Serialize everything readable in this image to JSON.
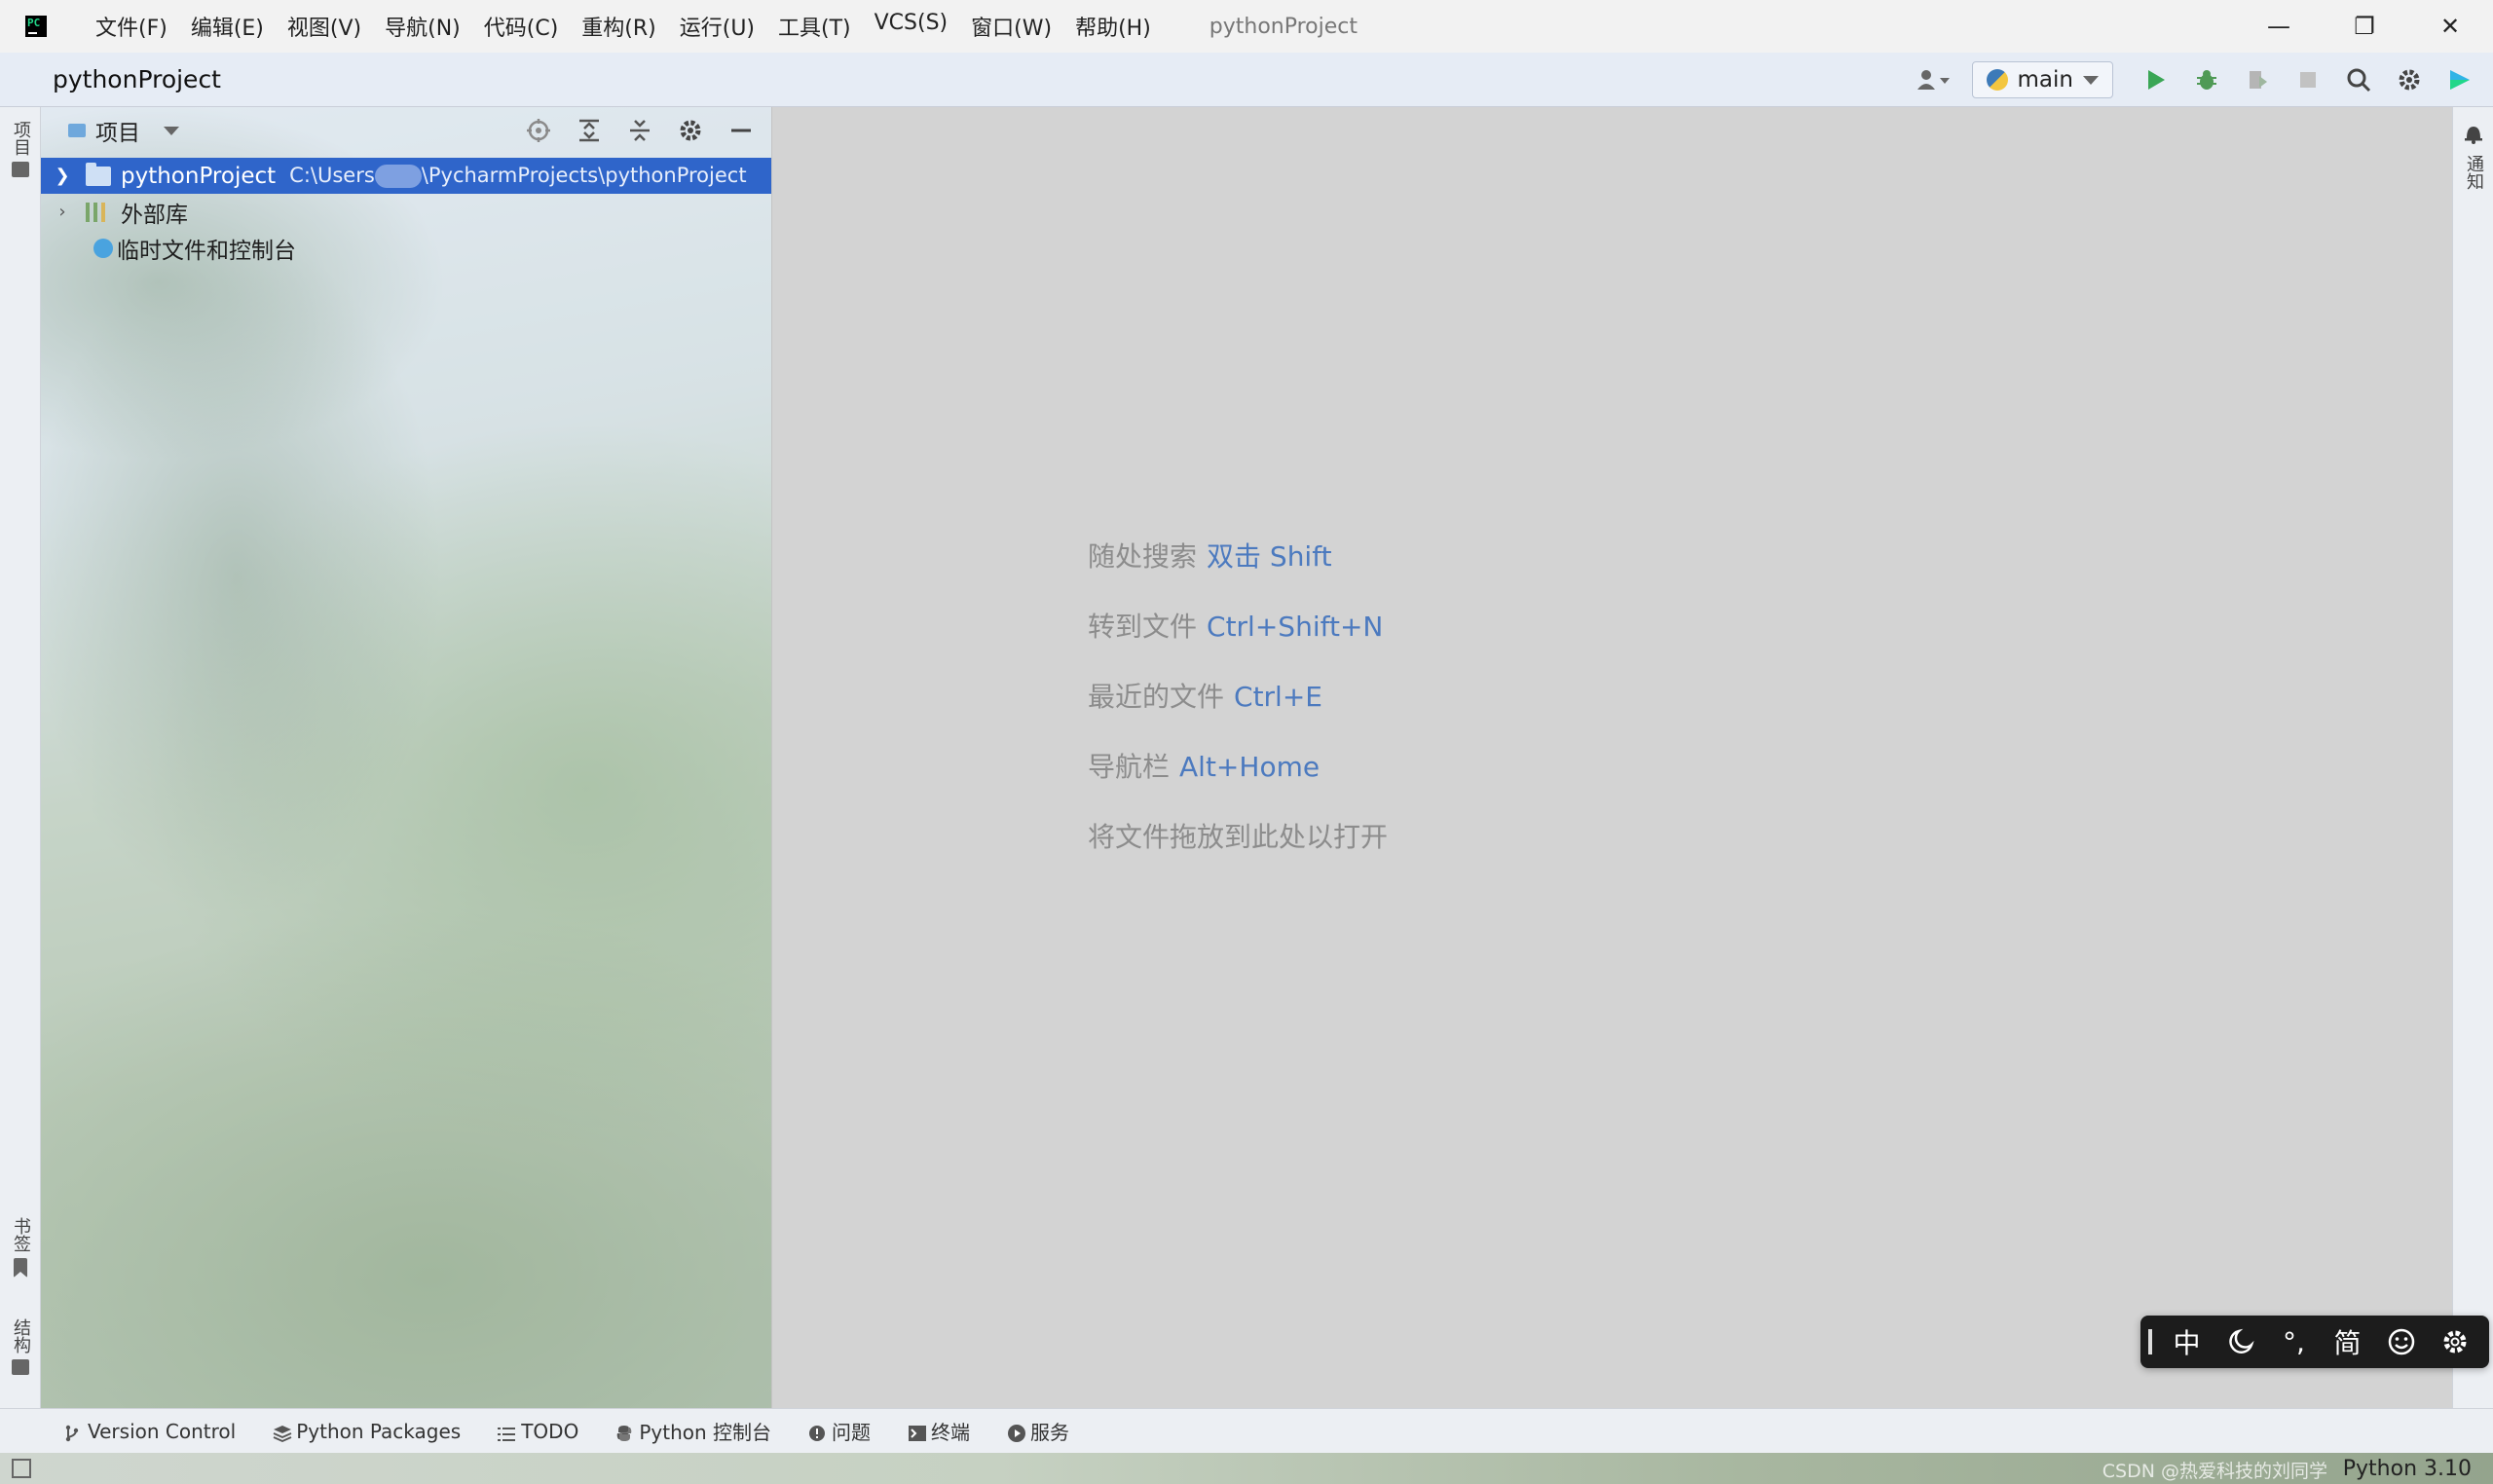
{
  "titlebar": {
    "menus": [
      "文件(F)",
      "编辑(E)",
      "视图(V)",
      "导航(N)",
      "代码(C)",
      "重构(R)",
      "运行(U)",
      "工具(T)",
      "VCS(S)",
      "窗口(W)",
      "帮助(H)"
    ],
    "window_title": "pythonProject",
    "minimize": "—",
    "restore": "❐",
    "close": "✕"
  },
  "navbar": {
    "project": "pythonProject",
    "run_config": "main"
  },
  "left_stripe": {
    "project": "项目",
    "bookmarks": "书签",
    "structure": "结构"
  },
  "right_stripe": {
    "notifications": "通知"
  },
  "project_panel": {
    "title": "项目",
    "tree": {
      "root_name": "pythonProject",
      "root_path_prefix": "C:\\Users",
      "root_path_suffix": "\\PycharmProjects\\pythonProject",
      "external_libs": "外部库",
      "scratches": "临时文件和控制台"
    }
  },
  "editor_hints": [
    {
      "label": "随处搜索",
      "key": "双击 Shift"
    },
    {
      "label": "转到文件",
      "key": "Ctrl+Shift+N"
    },
    {
      "label": "最近的文件",
      "key": "Ctrl+E"
    },
    {
      "label": "导航栏",
      "key": "Alt+Home"
    },
    {
      "label": "将文件拖放到此处以打开",
      "key": ""
    }
  ],
  "ime": {
    "mode": "中",
    "punct": "°,",
    "script": "简"
  },
  "bottom_tabs": [
    "Version Control",
    "Python Packages",
    "TODO",
    "Python 控制台",
    "问题",
    "终端",
    "服务"
  ],
  "status": {
    "watermark": "CSDN @热爱科技的刘同学",
    "interpreter": "Python 3.10"
  },
  "colors": {
    "selection": "#2f65ca",
    "hint_key": "#4c7abf",
    "run_green": "#3aa655"
  }
}
